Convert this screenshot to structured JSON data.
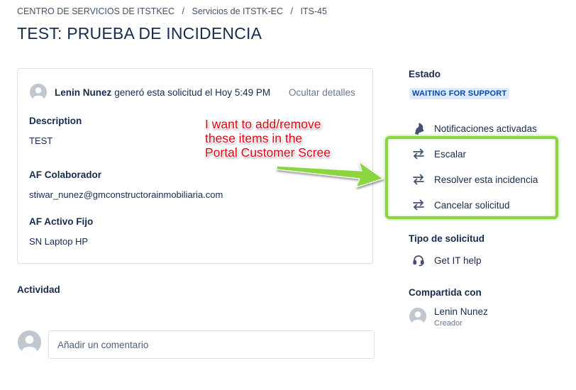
{
  "breadcrumb": [
    {
      "label": "CENTRO DE SERVICIOS DE ITSTKEC"
    },
    {
      "label": "Servicios de ITSTK-EC"
    },
    {
      "label": "ITS-45"
    }
  ],
  "breadcrumb_separator": "/",
  "title": "TEST: PRUEBA DE INCIDENCIA",
  "request": {
    "author": "Lenin Nunez",
    "action_text": "generó esta solicitud el Hoy 5:49 PM",
    "hide_details_label": "Ocultar detalles",
    "fields": [
      {
        "label": "Description",
        "value": "TEST"
      },
      {
        "label": "AF Colaborador",
        "value": "stiwar_nunez@gmconstructorainmobiliaria.com"
      },
      {
        "label": "AF Activo Fijo",
        "value": "SN Laptop HP"
      }
    ]
  },
  "activity": {
    "heading": "Actividad",
    "comment_placeholder": "Añadir un comentario"
  },
  "sidebar": {
    "status_heading": "Estado",
    "status_badge": "WAITING FOR SUPPORT",
    "notifications_label": "Notificaciones activadas",
    "actions": [
      {
        "label": "Escalar",
        "icon": "transition-arrows-icon"
      },
      {
        "label": "Resolver esta incidencia",
        "icon": "transition-arrows-icon"
      },
      {
        "label": "Cancelar solicitud",
        "icon": "transition-arrows-icon"
      }
    ],
    "request_type_heading": "Tipo de solicitud",
    "request_type_label": "Get IT help",
    "shared_heading": "Compartida con",
    "shared_user": {
      "name": "Lenin Nunez",
      "role": "Creador"
    }
  },
  "annotation": {
    "lines": [
      "I want to add/remove",
      "these items in the",
      "Portal Customer Scree"
    ],
    "text_color": "#e0000f",
    "highlight_color": "#8bd640"
  },
  "colors": {
    "status_badge_bg": "#deebff",
    "status_badge_text": "#0747a6",
    "text": "#172b4d",
    "muted": "#6b778c"
  }
}
